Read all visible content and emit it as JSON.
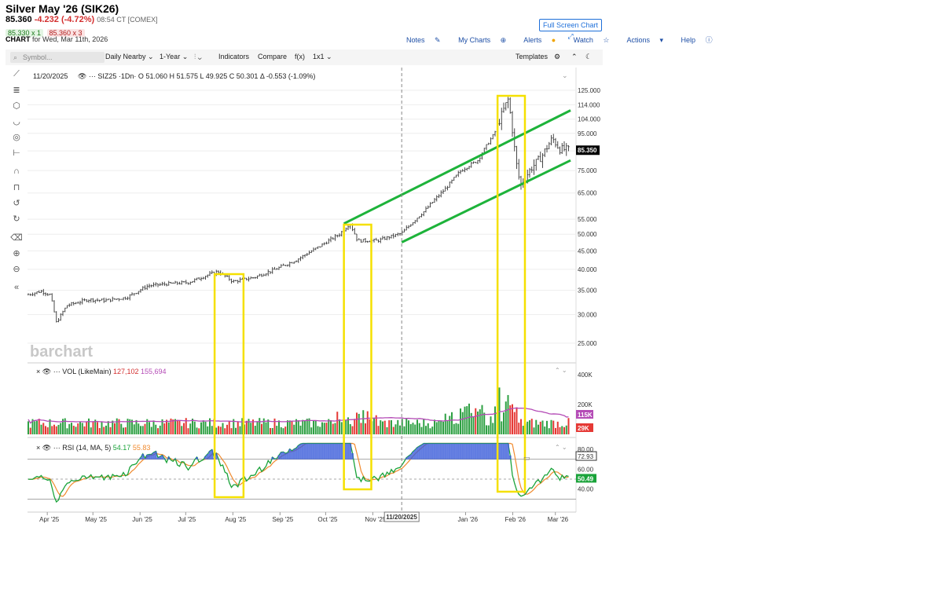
{
  "header": {
    "title": "Silver May '26 (SIK26)",
    "last": "85.360",
    "change": "-4.232 (-4.72%)",
    "time": "08:54 CT [COMEX]",
    "bid": "85.330 x 1",
    "ask": "85.360 x 3",
    "chart_label": "CHART",
    "chart_date": "for Wed, Mar 11th, 2026",
    "full_screen": "Full Screen Chart"
  },
  "nav": {
    "notes": "Notes",
    "my_charts": "My Charts",
    "alerts": "Alerts",
    "watch": "Watch",
    "actions": "Actions",
    "help": "Help"
  },
  "toolbar": {
    "search_placeholder": "Symbol...",
    "period": "Daily Nearby",
    "range": "1-Year",
    "indicators": "Indicators",
    "compare": "Compare",
    "fx": "f(x)",
    "layout": "1x1",
    "templates": "Templates"
  },
  "legend": {
    "date": "11/20/2025",
    "symbol": "SIZ25",
    "interval": "1Dn",
    "o_label": "O",
    "o": "51.060",
    "h_label": "H",
    "h": "51.575",
    "l_label": "L",
    "l": "49.925",
    "c_label": "C",
    "c": "50.301",
    "delta": "Δ -0.553 (-1.09%)",
    "vol_name": "VOL (LikeMain)",
    "vol_value": "127,102",
    "vol_ma": "155,694",
    "rsi_name": "RSI (14, MA, 5)",
    "rsi_value": "54.17",
    "rsi_ma": "55.83"
  },
  "watermark": "barchart",
  "crosshair_date": "11/20/2025",
  "chart_data": {
    "type": "ohlc",
    "symbol": "Silver May '26 (SIK26)",
    "price_axis": {
      "scale": "log",
      "ticks": [
        "25.000",
        "30.000",
        "35.000",
        "40.000",
        "45.000",
        "50.000",
        "55.000",
        "65.000",
        "75.000",
        "85.000",
        "95.000",
        "104.000",
        "114.000",
        "125.000"
      ],
      "current": "85.350"
    },
    "x_ticks": [
      "Apr '25",
      "May '25",
      "Jun '25",
      "Jul '25",
      "Aug '25",
      "Sep '25",
      "Oct '25",
      "Nov '25",
      "Jan '26",
      "Feb '26",
      "Mar '26"
    ],
    "price_path": [
      [
        "2025-03-21",
        34.2
      ],
      [
        "2025-03-28",
        34.8
      ],
      [
        "2025-04-03",
        34.0
      ],
      [
        "2025-04-07",
        28.5
      ],
      [
        "2025-04-14",
        31.8
      ],
      [
        "2025-04-28",
        33.0
      ],
      [
        "2025-05-09",
        32.8
      ],
      [
        "2025-05-23",
        33.4
      ],
      [
        "2025-06-06",
        36.0
      ],
      [
        "2025-06-20",
        36.5
      ],
      [
        "2025-07-03",
        36.8
      ],
      [
        "2025-07-22",
        39.5
      ],
      [
        "2025-08-01",
        37.0
      ],
      [
        "2025-08-15",
        38.0
      ],
      [
        "2025-08-29",
        40.0
      ],
      [
        "2025-09-12",
        42.5
      ],
      [
        "2025-09-26",
        46.0
      ],
      [
        "2025-10-10",
        50.0
      ],
      [
        "2025-10-17",
        53.5
      ],
      [
        "2025-10-22",
        48.0
      ],
      [
        "2025-11-04",
        48.0
      ],
      [
        "2025-11-20",
        50.3
      ],
      [
        "2025-12-05",
        58.0
      ],
      [
        "2025-12-19",
        67.0
      ],
      [
        "2025-12-29",
        75.0
      ],
      [
        "2026-01-09",
        80.0
      ],
      [
        "2026-01-20",
        95.0
      ],
      [
        "2026-01-29",
        118.0
      ],
      [
        "2026-02-03",
        80.0
      ],
      [
        "2026-02-06",
        68.0
      ],
      [
        "2026-02-13",
        76.0
      ],
      [
        "2026-02-20",
        82.0
      ],
      [
        "2026-02-27",
        92.0
      ],
      [
        "2026-03-04",
        86.0
      ],
      [
        "2026-03-11",
        85.36
      ]
    ],
    "volume_axis": {
      "ticks": [
        "200K",
        "400K"
      ],
      "current": "115K",
      "current_low": "29K"
    },
    "rsi_axis": {
      "ticks": [
        "40.00",
        "60.00",
        "80.00"
      ],
      "marks": [
        "72.93",
        "50.49"
      ]
    },
    "channel": {
      "upper": [
        [
          "2025-10-13",
          53.5
        ],
        [
          "2026-03-11",
          110.0
        ]
      ],
      "lower": [
        [
          "2025-11-20",
          47.5
        ],
        [
          "2026-03-11",
          80.0
        ]
      ]
    },
    "highlight_boxes": [
      {
        "start": "2025-07-20",
        "end": "2025-08-08"
      },
      {
        "start": "2025-10-13",
        "end": "2025-10-31"
      },
      {
        "start": "2026-01-22",
        "end": "2026-02-09"
      }
    ],
    "colors": {
      "up": "#2ea043",
      "down": "#e53935",
      "channel": "#1db33a",
      "box": "#f5e000",
      "vol_ma": "#b44bb6",
      "rsi": "#1aa33a",
      "rsi_ma": "#f08a2e"
    }
  }
}
